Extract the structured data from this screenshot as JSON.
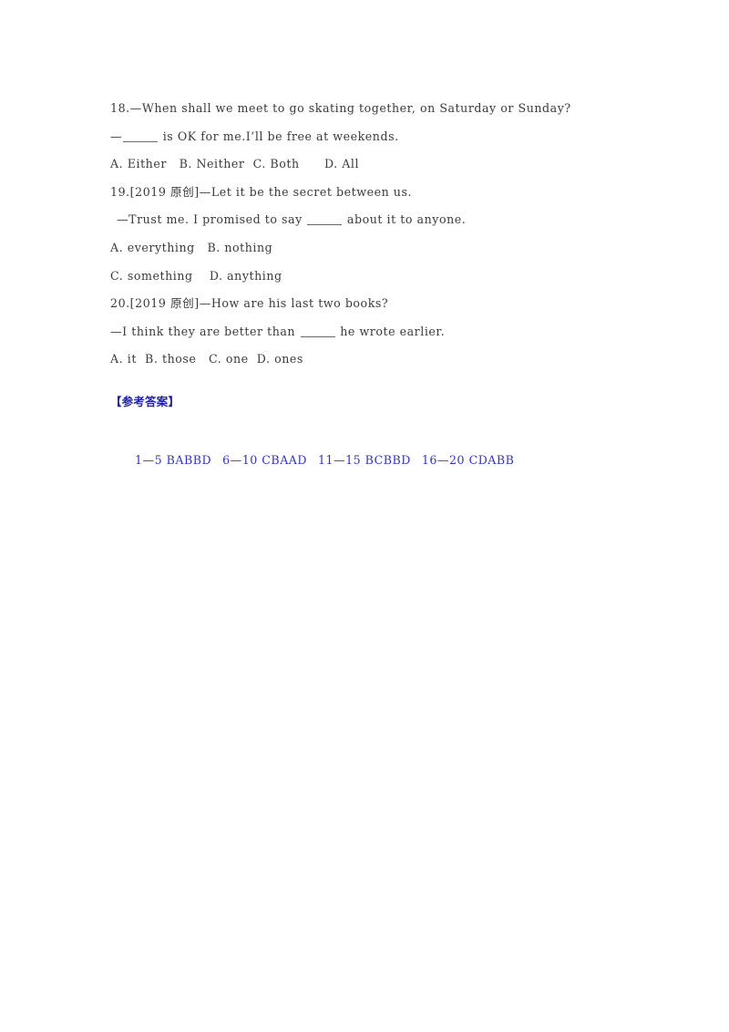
{
  "document": {
    "type": "english-multiple-choice-worksheet",
    "background_color": "#ffffff",
    "text_color": "#3c3c3c",
    "answer_color": "#3333bb"
  },
  "questions": [
    {
      "number": "18.",
      "stem_prefix": "18.",
      "stem_line_1": "18.—When shall we meet to go skating together, on Saturday or Sunday?",
      "stem_line_2_before": "—",
      "stem_line_2_after": " is OK for me.I’ll be free at weekends.",
      "options_line": "A. Either   B. Neither  C. Both      D. All"
    },
    {
      "number": "19.",
      "stem_line_1": "19.[2019 原创]—Let it be the secret between us.",
      "stem_line_2_before": "—Trust me. I promised to say ",
      "stem_line_2_after": " about it to anyone.",
      "options_line_1": "A. everything   B. nothing",
      "options_line_2": "C. something    D. anything"
    },
    {
      "number": "20.",
      "stem_line_1": "20.[2019 原创]—How are his last two books?",
      "stem_line_2_before": "—I think they are better than ",
      "stem_line_2_after": " he wrote earlier.",
      "options_line": "A. it  B. those   C. one  D. ones"
    }
  ],
  "answer_key": {
    "heading": "【参考答案】",
    "groups": [
      {
        "range": "1—5",
        "answers": "BABBD"
      },
      {
        "range": "6—10",
        "answers": "CBAAD"
      },
      {
        "range": "11—15",
        "answers": "BCBBD"
      },
      {
        "range": "16—20",
        "answers": "CDABB"
      }
    ]
  }
}
